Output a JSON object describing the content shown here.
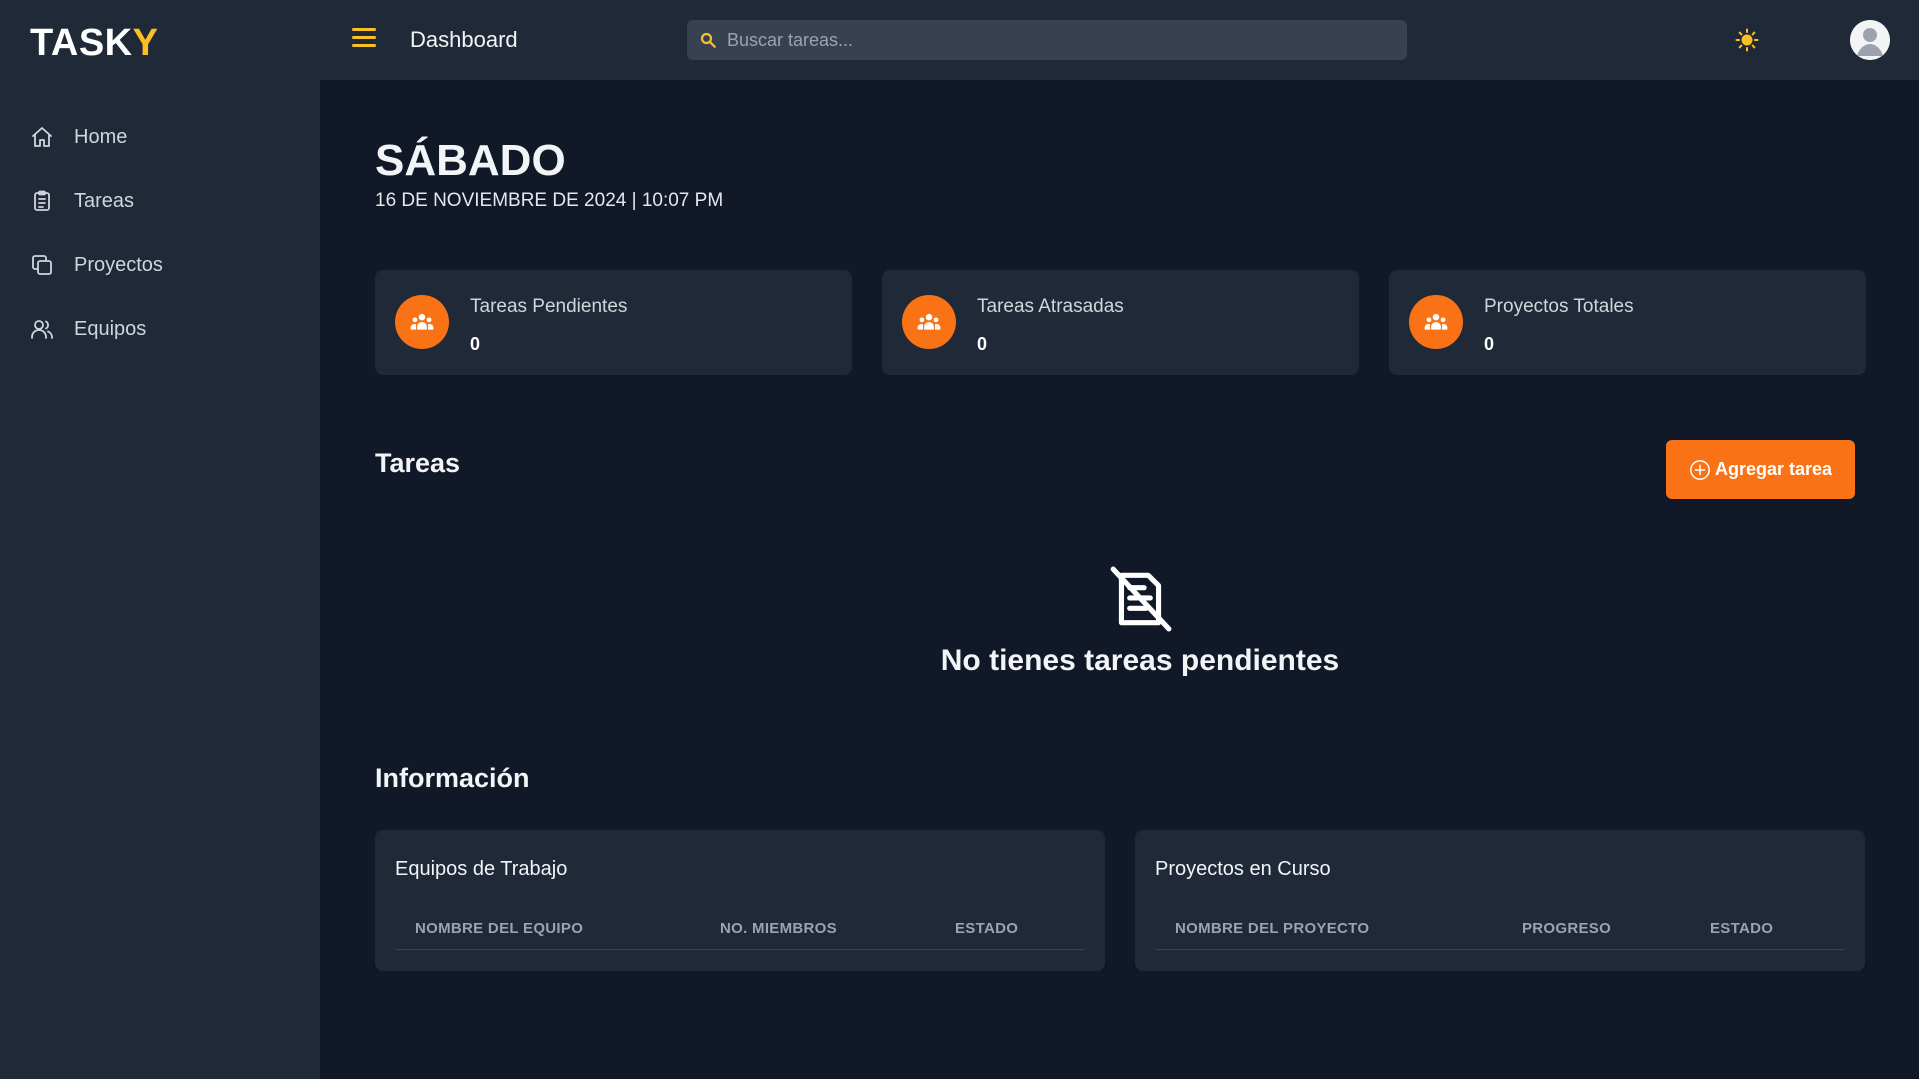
{
  "app": {
    "logo_main": "TASK",
    "logo_accent": "Y"
  },
  "colors": {
    "accent": "#f97316",
    "logo_accent": "#fbbf24",
    "background": "#111827",
    "panel": "#1f2937"
  },
  "sidebar": {
    "items": [
      {
        "label": "Home",
        "icon": "home-icon"
      },
      {
        "label": "Tareas",
        "icon": "clipboard-icon"
      },
      {
        "label": "Proyectos",
        "icon": "copy-icon"
      },
      {
        "label": "Equipos",
        "icon": "users-icon"
      }
    ]
  },
  "header": {
    "menu_icon": "hamburger-icon",
    "title": "Dashboard",
    "search_placeholder": "Buscar tareas...",
    "search_icon": "search-icon",
    "theme_icon": "sun-icon",
    "avatar_icon": "user-avatar-icon"
  },
  "main": {
    "day": "SÁBADO",
    "date": "16 DE NOVIEMBRE DE 2024 | 10:07 PM",
    "stats": [
      {
        "label": "Tareas Pendientes",
        "value": "0",
        "icon": "group-icon"
      },
      {
        "label": "Tareas Atrasadas",
        "value": "0",
        "icon": "group-icon"
      },
      {
        "label": "Proyectos Totales",
        "value": "0",
        "icon": "group-icon"
      }
    ],
    "tasks_title": "Tareas",
    "add_task_label": "Agregar tarea",
    "add_task_icon": "plus-circle-icon",
    "empty_icon": "no-notes-icon",
    "empty_text": "No tienes tareas pendientes",
    "info_title": "Información",
    "teams_card": {
      "title": "Equipos de Trabajo",
      "columns": [
        "NOMBRE DEL EQUIPO",
        "NO. MIEMBROS",
        "ESTADO"
      ]
    },
    "projects_card": {
      "title": "Proyectos en Curso",
      "columns": [
        "NOMBRE DEL PROYECTO",
        "PROGRESO",
        "ESTADO"
      ]
    }
  }
}
